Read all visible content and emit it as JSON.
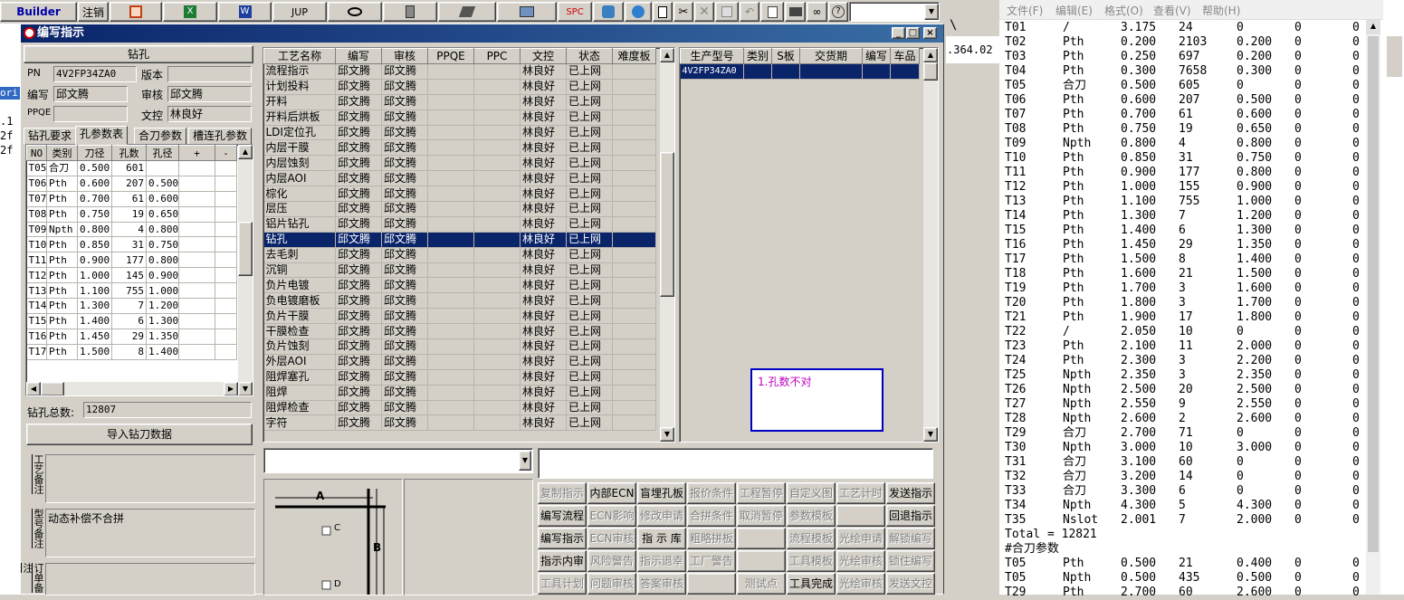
{
  "toolbar": {
    "builder": "Builder",
    "logout": "注销",
    "jup": "JUP",
    "spc": "SPC"
  },
  "dialog": {
    "title": "编写指示"
  },
  "left": {
    "section_title": "钻孔",
    "pn_label": "PN",
    "pn_value": "4V2FP34ZA0",
    "version_label": "版本",
    "version_value": "",
    "writer_label": "编写",
    "writer_value": "邱文腾",
    "review_label": "审核",
    "review_value": "邱文腾",
    "ppqe_label": "PPQE",
    "ppqe_value": "",
    "docctrl_label": "文控",
    "docctrl_value": "林良好",
    "tabs": [
      "钻孔要求",
      "孔参数表",
      "合刀参数",
      "槽连孔参数"
    ],
    "hole_headers": [
      "NO",
      "类别",
      "刀径",
      "孔数",
      "孔径",
      "+",
      "-"
    ],
    "hole_rows": [
      [
        "T05",
        "合刀",
        "0.500",
        "601",
        ""
      ],
      [
        "T06",
        "Pth",
        "0.600",
        "207",
        "0.500"
      ],
      [
        "T07",
        "Pth",
        "0.700",
        "61",
        "0.600"
      ],
      [
        "T08",
        "Pth",
        "0.750",
        "19",
        "0.650"
      ],
      [
        "T09",
        "Npth",
        "0.800",
        "4",
        "0.800"
      ],
      [
        "T10",
        "Pth",
        "0.850",
        "31",
        "0.750"
      ],
      [
        "T11",
        "Pth",
        "0.900",
        "177",
        "0.800"
      ],
      [
        "T12",
        "Pth",
        "1.000",
        "145",
        "0.900"
      ],
      [
        "T13",
        "Pth",
        "1.100",
        "755",
        "1.000"
      ],
      [
        "T14",
        "Pth",
        "1.300",
        "7",
        "1.200"
      ],
      [
        "T15",
        "Pth",
        "1.400",
        "6",
        "1.300"
      ],
      [
        "T16",
        "Pth",
        "1.450",
        "29",
        "1.350"
      ],
      [
        "T17",
        "Pth",
        "1.500",
        "8",
        "1.400"
      ]
    ],
    "total_label": "钻孔总数:",
    "total_value": "12807",
    "import_button": "导入钻刀数据",
    "process_note_label": "工艺备注",
    "process_note": "",
    "model_note_label": "型号备注",
    "model_note": "动态补偿不合拼",
    "order_note_label": "订单备注",
    "order_note": ""
  },
  "process": {
    "headers": [
      "工艺名称",
      "编写",
      "审核",
      "PPQE",
      "PPC",
      "文控",
      "状态",
      "难度板"
    ],
    "rows": [
      [
        "流程指示",
        "邱文腾",
        "邱文腾",
        "",
        "",
        "林良好",
        "已上网",
        ""
      ],
      [
        "计划投料",
        "邱文腾",
        "邱文腾",
        "",
        "",
        "林良好",
        "已上网",
        ""
      ],
      [
        "开料",
        "邱文腾",
        "邱文腾",
        "",
        "",
        "林良好",
        "已上网",
        ""
      ],
      [
        "开料后烘板",
        "邱文腾",
        "邱文腾",
        "",
        "",
        "林良好",
        "已上网",
        ""
      ],
      [
        "LDI定位孔",
        "邱文腾",
        "邱文腾",
        "",
        "",
        "林良好",
        "已上网",
        ""
      ],
      [
        "内层干膜",
        "邱文腾",
        "邱文腾",
        "",
        "",
        "林良好",
        "已上网",
        ""
      ],
      [
        "内层蚀刻",
        "邱文腾",
        "邱文腾",
        "",
        "",
        "林良好",
        "已上网",
        ""
      ],
      [
        "内层AOI",
        "邱文腾",
        "邱文腾",
        "",
        "",
        "林良好",
        "已上网",
        ""
      ],
      [
        "棕化",
        "邱文腾",
        "邱文腾",
        "",
        "",
        "林良好",
        "已上网",
        ""
      ],
      [
        "层压",
        "邱文腾",
        "邱文腾",
        "",
        "",
        "林良好",
        "已上网",
        ""
      ],
      [
        "铝片钻孔",
        "邱文腾",
        "邱文腾",
        "",
        "",
        "林良好",
        "已上网",
        ""
      ],
      [
        "钻孔",
        "邱文腾",
        "邱文腾",
        "",
        "",
        "林良好",
        "已上网",
        ""
      ],
      [
        "去毛刺",
        "邱文腾",
        "邱文腾",
        "",
        "",
        "林良好",
        "已上网",
        ""
      ],
      [
        "沉铜",
        "邱文腾",
        "邱文腾",
        "",
        "",
        "林良好",
        "已上网",
        ""
      ],
      [
        "负片电镀",
        "邱文腾",
        "邱文腾",
        "",
        "",
        "林良好",
        "已上网",
        ""
      ],
      [
        "负电镀磨板",
        "邱文腾",
        "邱文腾",
        "",
        "",
        "林良好",
        "已上网",
        ""
      ],
      [
        "负片干膜",
        "邱文腾",
        "邱文腾",
        "",
        "",
        "林良好",
        "已上网",
        ""
      ],
      [
        "干膜检查",
        "邱文腾",
        "邱文腾",
        "",
        "",
        "林良好",
        "已上网",
        ""
      ],
      [
        "负片蚀刻",
        "邱文腾",
        "邱文腾",
        "",
        "",
        "林良好",
        "已上网",
        ""
      ],
      [
        "外层AOI",
        "邱文腾",
        "邱文腾",
        "",
        "",
        "林良好",
        "已上网",
        ""
      ],
      [
        "阻焊塞孔",
        "邱文腾",
        "邱文腾",
        "",
        "",
        "林良好",
        "已上网",
        ""
      ],
      [
        "阻焊",
        "邱文腾",
        "邱文腾",
        "",
        "",
        "林良好",
        "已上网",
        ""
      ],
      [
        "阻焊检查",
        "邱文腾",
        "邱文腾",
        "",
        "",
        "林良好",
        "已上网",
        ""
      ],
      [
        "字符",
        "邱文腾",
        "邱文腾",
        "",
        "",
        "林良好",
        "已上网",
        ""
      ]
    ],
    "selected_index": 11
  },
  "prod": {
    "headers": [
      "生产型号",
      "类别",
      "S板",
      "交货期",
      "编写",
      "车品"
    ],
    "rows": [
      [
        "4V2FP34ZA0",
        "",
        "",
        "",
        "",
        ""
      ]
    ],
    "note": "1.孔数不对"
  },
  "diagram": {
    "a": "A",
    "b": "B",
    "c": "C",
    "d": "D"
  },
  "actions": [
    [
      "复制指示",
      "内部ECN",
      "盲埋孔板",
      "报价条件",
      "工程暂停",
      "自定义图",
      "工艺计时",
      "发送指示"
    ],
    [
      "编写流程",
      "ECN影响",
      "修改申请",
      "合拼条件",
      "取消暂停",
      "参数模板",
      "",
      "回退指示"
    ],
    [
      "编写指示",
      "ECN审核",
      "指 示 库",
      "粗略拼板",
      "",
      "流程模板",
      "光绘申请",
      "解锁编写"
    ],
    [
      "指示内审",
      "风险警告",
      "指示退幸",
      "工厂警告",
      "",
      "工具模板",
      "光绘审核",
      "锁住编写"
    ],
    [
      "工具计划",
      "问题审核",
      "答案审核",
      "",
      "测试点",
      "工具完成",
      "光绘审核",
      "发送文控"
    ]
  ],
  "actions_disabled": [
    [
      1,
      0,
      0,
      1,
      1,
      1,
      1,
      0
    ],
    [
      0,
      1,
      1,
      1,
      1,
      1,
      0,
      0
    ],
    [
      0,
      1,
      0,
      1,
      0,
      1,
      1,
      1
    ],
    [
      0,
      1,
      1,
      1,
      0,
      1,
      1,
      1
    ],
    [
      1,
      1,
      1,
      0,
      1,
      0,
      1,
      1
    ]
  ],
  "notepad": {
    "menu": [
      "文件(F)",
      "编辑(E)",
      "格式(O)",
      "查看(V)",
      "帮助(H)"
    ],
    "lines": [
      [
        "T01",
        "/",
        "3.175",
        "24",
        "0",
        "0",
        "0"
      ],
      [
        "T02",
        "Pth",
        "0.200",
        "2103",
        "0.200",
        "0",
        "0"
      ],
      [
        "T03",
        "Pth",
        "0.250",
        "697",
        "0.200",
        "0",
        "0"
      ],
      [
        "T04",
        "Pth",
        "0.300",
        "7658",
        "0.300",
        "0",
        "0"
      ],
      [
        "T05",
        "合刀",
        "0.500",
        "605",
        "0",
        "0",
        "0"
      ],
      [
        "T06",
        "Pth",
        "0.600",
        "207",
        "0.500",
        "0",
        "0"
      ],
      [
        "T07",
        "Pth",
        "0.700",
        "61",
        "0.600",
        "0",
        "0"
      ],
      [
        "T08",
        "Pth",
        "0.750",
        "19",
        "0.650",
        "0",
        "0"
      ],
      [
        "T09",
        "Npth",
        "0.800",
        "4",
        "0.800",
        "0",
        "0"
      ],
      [
        "T10",
        "Pth",
        "0.850",
        "31",
        "0.750",
        "0",
        "0"
      ],
      [
        "T11",
        "Pth",
        "0.900",
        "177",
        "0.800",
        "0",
        "0"
      ],
      [
        "T12",
        "Pth",
        "1.000",
        "155",
        "0.900",
        "0",
        "0"
      ],
      [
        "T13",
        "Pth",
        "1.100",
        "755",
        "1.000",
        "0",
        "0"
      ],
      [
        "T14",
        "Pth",
        "1.300",
        "7",
        "1.200",
        "0",
        "0"
      ],
      [
        "T15",
        "Pth",
        "1.400",
        "6",
        "1.300",
        "0",
        "0"
      ],
      [
        "T16",
        "Pth",
        "1.450",
        "29",
        "1.350",
        "0",
        "0"
      ],
      [
        "T17",
        "Pth",
        "1.500",
        "8",
        "1.400",
        "0",
        "0"
      ],
      [
        "T18",
        "Pth",
        "1.600",
        "21",
        "1.500",
        "0",
        "0"
      ],
      [
        "T19",
        "Pth",
        "1.700",
        "3",
        "1.600",
        "0",
        "0"
      ],
      [
        "T20",
        "Pth",
        "1.800",
        "3",
        "1.700",
        "0",
        "0"
      ],
      [
        "T21",
        "Pth",
        "1.900",
        "17",
        "1.800",
        "0",
        "0"
      ],
      [
        "T22",
        "/",
        "2.050",
        "10",
        "0",
        "0",
        "0"
      ],
      [
        "T23",
        "Pth",
        "2.100",
        "11",
        "2.000",
        "0",
        "0"
      ],
      [
        "T24",
        "Pth",
        "2.300",
        "3",
        "2.200",
        "0",
        "0"
      ],
      [
        "T25",
        "Npth",
        "2.350",
        "3",
        "2.350",
        "0",
        "0"
      ],
      [
        "T26",
        "Npth",
        "2.500",
        "20",
        "2.500",
        "0",
        "0"
      ],
      [
        "T27",
        "Npth",
        "2.550",
        "9",
        "2.550",
        "0",
        "0"
      ],
      [
        "T28",
        "Npth",
        "2.600",
        "2",
        "2.600",
        "0",
        "0"
      ],
      [
        "T29",
        "合刀",
        "2.700",
        "71",
        "0",
        "0",
        "0"
      ],
      [
        "T30",
        "Npth",
        "3.000",
        "10",
        "3.000",
        "0",
        "0"
      ],
      [
        "T31",
        "合刀",
        "3.100",
        "60",
        "0",
        "0",
        "0"
      ],
      [
        "T32",
        "合刀",
        "3.200",
        "14",
        "0",
        "0",
        "0"
      ],
      [
        "T33",
        "合刀",
        "3.300",
        "6",
        "0",
        "0",
        "0"
      ],
      [
        "T34",
        "Npth",
        "4.300",
        "5",
        "4.300",
        "0",
        "0"
      ],
      [
        "T35",
        "Nslot",
        "2.001",
        "7",
        "2.000",
        "0",
        "0"
      ]
    ],
    "total": "Total = 12821",
    "section": "#合刀参数",
    "tail": [
      [
        "T05",
        "Pth",
        "0.500",
        "21",
        "0.400",
        "0",
        "0"
      ],
      [
        "T05",
        "Npth",
        "0.500",
        "435",
        "0.500",
        "0",
        "0"
      ],
      [
        "T29",
        "Pth",
        "2.700",
        "60",
        "2.600",
        "0",
        "0"
      ]
    ]
  },
  "bg_fragments": {
    "num": ".364.02",
    "backslash": "\\"
  }
}
